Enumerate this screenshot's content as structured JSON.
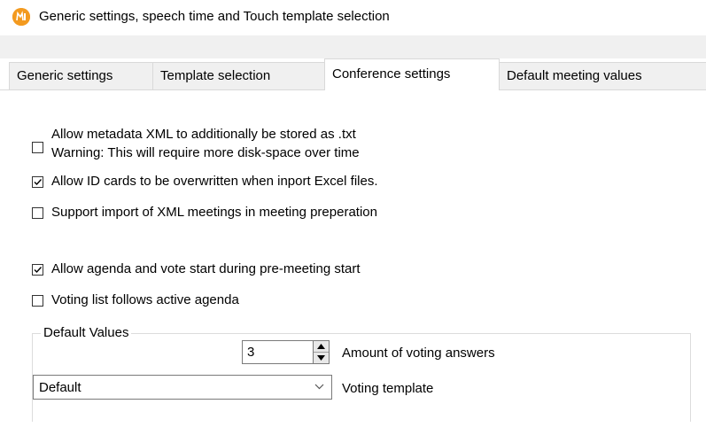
{
  "window": {
    "title": "Generic settings, speech time and Touch template selection",
    "icon": "app-logo-icon",
    "icon_color": "#f39a1f"
  },
  "tabs": [
    {
      "label": "Generic settings",
      "active": false
    },
    {
      "label": "Template selection",
      "active": false
    },
    {
      "label": "Conference settings",
      "active": true
    },
    {
      "label": "Default meeting values",
      "active": false
    }
  ],
  "options": [
    {
      "label": "Allow metadata XML to additionally be stored as .txt",
      "subtext": "Warning: This will require more disk-space over time",
      "checked": false
    },
    {
      "label": "Allow ID cards to be overwritten when inport Excel files.",
      "checked": true
    },
    {
      "label": "Support import of XML meetings in meeting preperation",
      "checked": false
    },
    {
      "label": "Allow agenda and vote start during pre-meeting start",
      "checked": true
    },
    {
      "label": "Voting list follows active agenda",
      "checked": false
    }
  ],
  "default_values": {
    "legend": "Default Values",
    "voting_answers": {
      "value": "3",
      "label": "Amount of voting answers"
    },
    "voting_template": {
      "value": "Default",
      "label": "Voting template"
    }
  }
}
